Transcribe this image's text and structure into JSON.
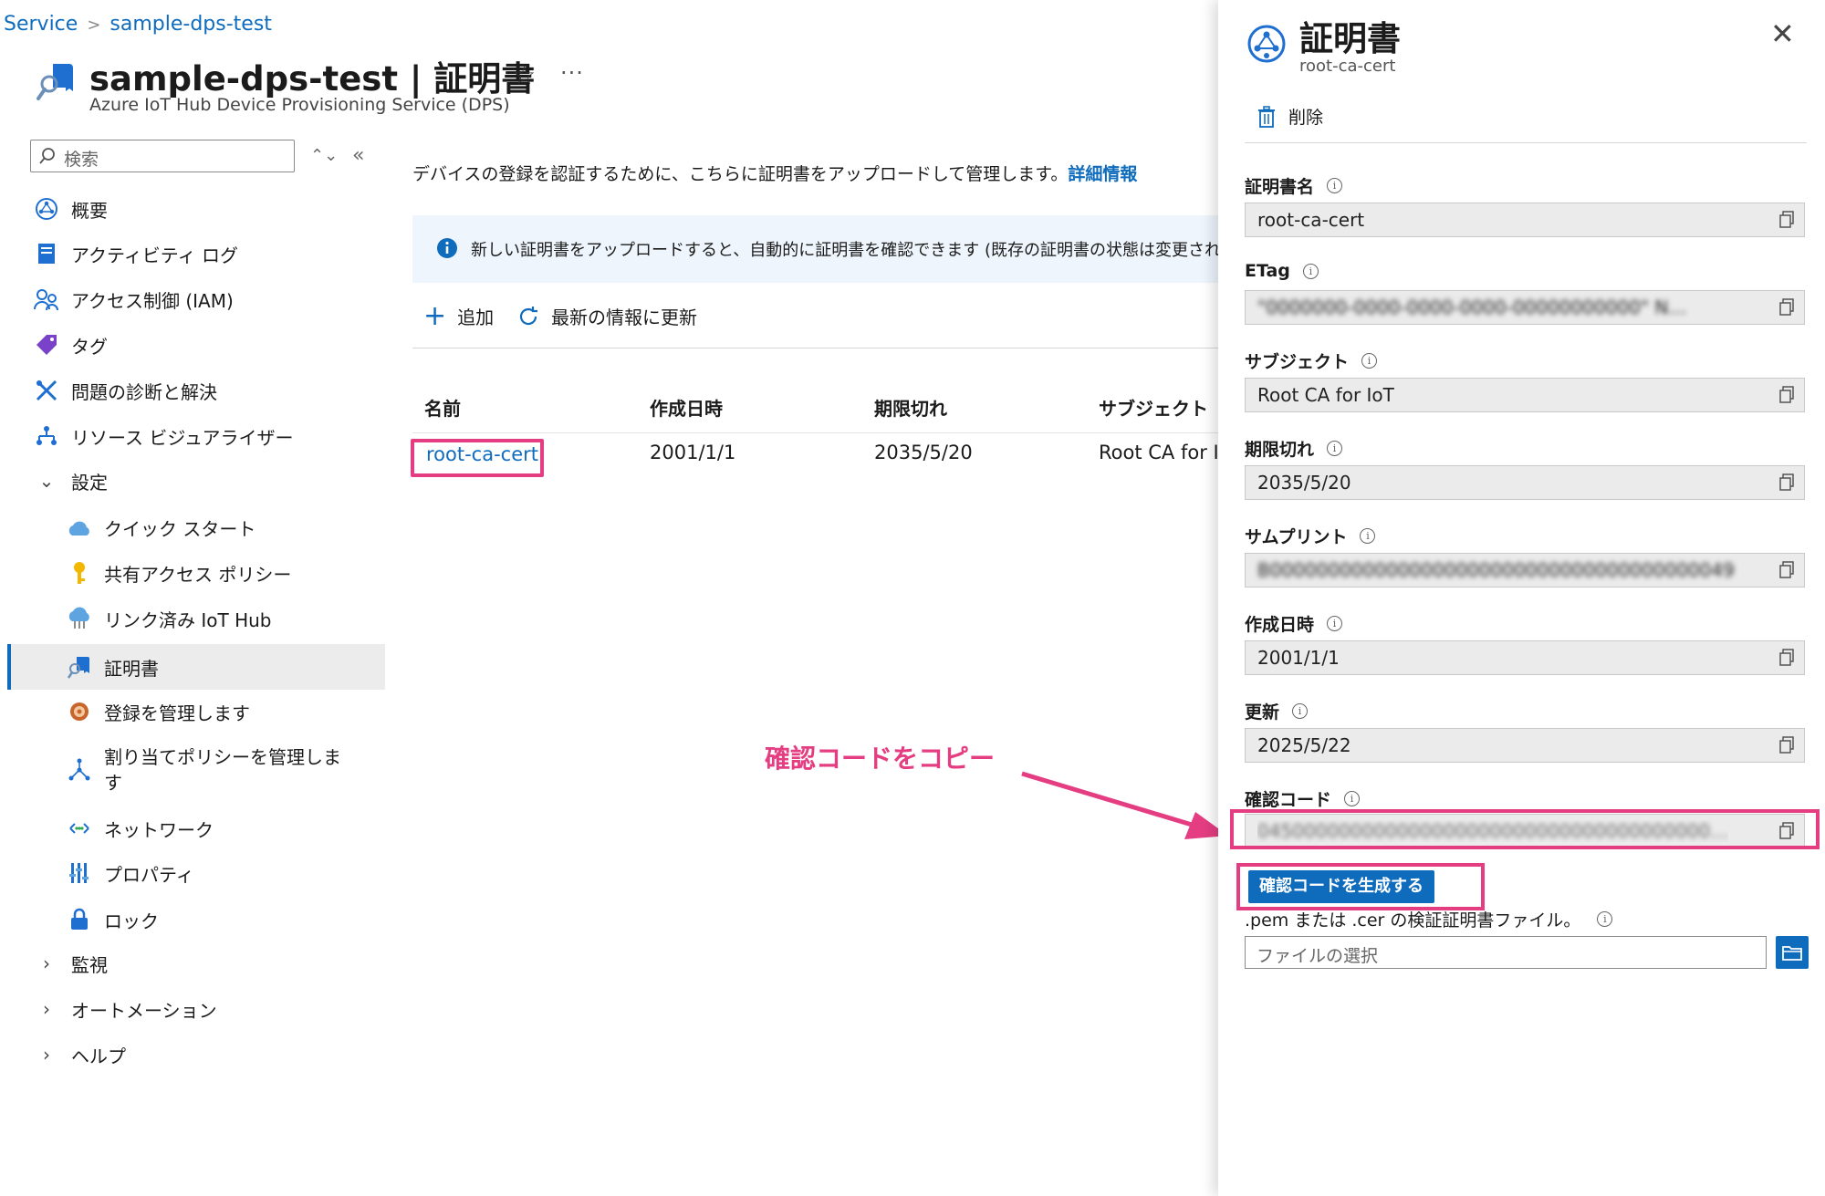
{
  "breadcrumb": {
    "items": [
      "Service",
      "sample-dps-test"
    ]
  },
  "header": {
    "title": "sample-dps-test | 証明書",
    "subtitle": "Azure IoT Hub Device Provisioning Service (DPS)",
    "more": "···"
  },
  "sidebar": {
    "search_placeholder": "検索",
    "items": [
      {
        "label": "概要",
        "icon": "overview-icon"
      },
      {
        "label": "アクティビティ ログ",
        "icon": "activity-log-icon"
      },
      {
        "label": "アクセス制御 (IAM)",
        "icon": "iam-icon"
      },
      {
        "label": "タグ",
        "icon": "tag-icon"
      },
      {
        "label": "問題の診断と解決",
        "icon": "diagnose-icon"
      },
      {
        "label": "リソース ビジュアライザー",
        "icon": "visualizer-icon"
      },
      {
        "label": "設定",
        "icon": "chevron-down-icon"
      },
      {
        "label": "クイック スタート",
        "icon": "quickstart-icon"
      },
      {
        "label": "共有アクセス ポリシー",
        "icon": "key-icon"
      },
      {
        "label": "リンク済み IoT Hub",
        "icon": "iot-hub-icon"
      },
      {
        "label": "証明書",
        "icon": "certificate-icon"
      },
      {
        "label": "登録を管理します",
        "icon": "enrollment-icon"
      },
      {
        "label": "割り当てポリシーを管理しま",
        "label2": "す",
        "icon": "allocation-icon"
      },
      {
        "label": "ネットワーク",
        "icon": "network-icon"
      },
      {
        "label": "プロパティ",
        "icon": "properties-icon"
      },
      {
        "label": "ロック",
        "icon": "lock-icon"
      },
      {
        "label": "監視",
        "icon": "chevron-right-icon"
      },
      {
        "label": "オートメーション",
        "icon": "chevron-right-icon"
      },
      {
        "label": "ヘルプ",
        "icon": "chevron-right-icon"
      }
    ]
  },
  "main": {
    "description": "デバイスの登録を認証するために、こちらに証明書をアップロードして管理します。",
    "learn_more": "詳細情報",
    "info_banner": "新しい証明書をアップロードすると、自動的に証明書を確認できます (既存の証明書の状態は変更されない",
    "toolbar": {
      "add": "追加",
      "refresh": "最新の情報に更新"
    },
    "table": {
      "columns": [
        "名前",
        "作成日時",
        "期限切れ",
        "サブジェクト"
      ],
      "rows": [
        {
          "name": "root-ca-cert",
          "created": "2001/1/1",
          "expires": "2035/5/20",
          "subject": "Root CA for Io"
        }
      ]
    }
  },
  "annotation": {
    "text": "確認コードをコピー",
    "color": "#e53d82"
  },
  "panel": {
    "title": "証明書",
    "subtitle": "root-ca-cert",
    "delete": "削除",
    "fields": [
      {
        "label": "証明書名",
        "value": "root-ca-cert"
      },
      {
        "label": "ETag",
        "value": "\"0000000-0000-0000-0000-00000000000\" N…"
      },
      {
        "label": "サブジェクト",
        "value": "Root CA for IoT"
      },
      {
        "label": "期限切れ",
        "value": "2035/5/20"
      },
      {
        "label": "サムプリント",
        "value": "B0000000000000000000000000000000000000049"
      },
      {
        "label": "作成日時",
        "value": "2001/1/1"
      },
      {
        "label": "更新",
        "value": "2025/5/22"
      },
      {
        "label": "確認コード",
        "value": "045000000000000000000000000000000000000…"
      }
    ],
    "generate_button": "確認コードを生成する",
    "file_label": ".pem または .cer の検証証明書ファイル。",
    "file_placeholder": "ファイルの選択"
  },
  "colors": {
    "accent": "#0f6cbd",
    "highlight": "#e53d82",
    "selected_bg": "#ececec",
    "info_bg": "#eef5fc"
  }
}
